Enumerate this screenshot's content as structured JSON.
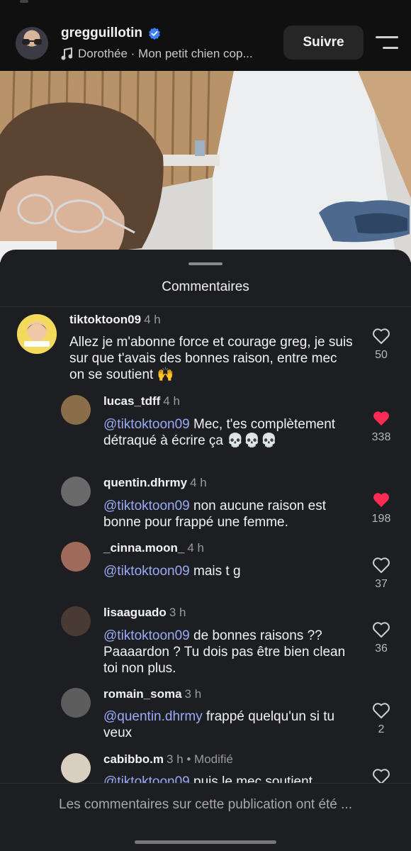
{
  "header": {
    "username": "gregguillotin",
    "music": "Dorothée · Mon petit chien cop...",
    "follow_label": "Suivre"
  },
  "sheet": {
    "title": "Commentaires",
    "footer": "Les commentaires sur cette publication ont été ..."
  },
  "comments": [
    {
      "user": "tiktoktoon09",
      "time": "4 h",
      "text": "Allez je m'abonne force et courage greg, je suis sur que t'avais des bonnes raison, entre mec on se soutient 🙌",
      "likes": "50",
      "liked": false
    },
    {
      "user": "lucas_tdff",
      "time": "4 h",
      "mention": "@tiktoktoon09",
      "text": " Mec, t'es complètement détraqué à écrire ça 💀💀💀",
      "likes": "338",
      "liked": true
    },
    {
      "user": "quentin.dhrmy",
      "time": "4 h",
      "mention": "@tiktoktoon09",
      "text": " non aucune raison est bonne pour frappé une femme.",
      "likes": "198",
      "liked": true
    },
    {
      "user": "_cinna.moon_",
      "time": "4 h",
      "mention": "@tiktoktoon09",
      "text": " mais t g",
      "likes": "37",
      "liked": false
    },
    {
      "user": "lisaaguado",
      "time": "3 h",
      "mention": "@tiktoktoon09",
      "text": " de bonnes raisons ?? Paaaardon ? Tu dois pas être bien clean toi non plus.",
      "likes": "36",
      "liked": false
    },
    {
      "user": "romain_soma",
      "time": "3 h",
      "mention": "@quentin.dhrmy",
      "text": " frappé quelqu'un si tu veux",
      "likes": "2",
      "liked": false
    },
    {
      "user": "cabibbo.m",
      "time": "3 h • Modifié",
      "mention": "@tiktoktoon09",
      "text": " puis le mec soutient",
      "likes": "",
      "liked": false
    }
  ],
  "colors": {
    "accent_like": "#fe2c55",
    "mention": "#9aaaf5",
    "verified": "#3b82f6"
  },
  "icons": [
    "verified-badge-icon",
    "music-note-icon",
    "menu-icon",
    "heart-icon",
    "heart-filled-icon"
  ]
}
